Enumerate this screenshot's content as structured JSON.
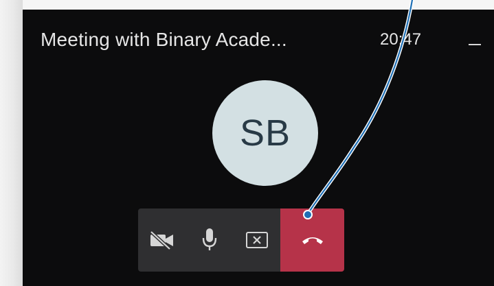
{
  "window": {
    "title": "Meeting with Binary Acade...",
    "timer": "20:47"
  },
  "participant": {
    "initials": "SB"
  },
  "controls": [
    {
      "icon": "video-off-icon",
      "action": "toggle-video"
    },
    {
      "icon": "microphone-icon",
      "action": "toggle-mute"
    },
    {
      "icon": "share-screen-icon",
      "action": "share-screen"
    },
    {
      "icon": "hang-up-icon",
      "action": "end-call"
    }
  ],
  "colors": {
    "window_bg": "#0c0c0d",
    "control_bg": "#2f2f31",
    "end_call": "#b63349",
    "avatar_bg": "#d3e0e3",
    "avatar_text": "#283a46",
    "annotation_line": "#1e6fb5"
  }
}
